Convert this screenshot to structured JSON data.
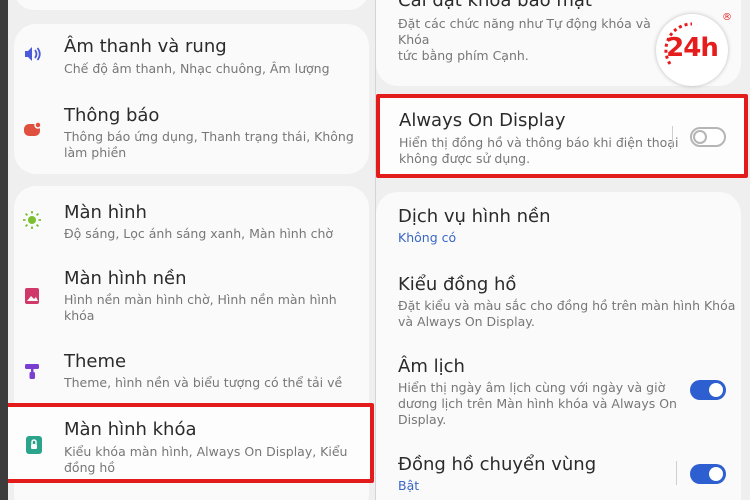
{
  "left_panel": {
    "items": [
      {
        "title": "Âm thanh và rung",
        "subtitle": "Chế độ âm thanh, Nhạc chuông, Âm lượng",
        "icon": "speaker-icon",
        "color": "#4a5ad8"
      },
      {
        "title": "Thông báo",
        "subtitle_lines": [
          "Thông báo ứng dụng, Thanh trạng thái, Không",
          "làm phiền"
        ],
        "icon": "notification-icon",
        "color": "#e0503f"
      },
      {
        "title": "Màn hình",
        "subtitle": "Độ sáng, Lọc ánh sáng xanh, Màn hình chờ",
        "icon": "brightness-icon",
        "color": "#7cbf2f"
      },
      {
        "title": "Màn hình nền",
        "subtitle_lines": [
          "Hình nền màn hình chờ, Hình nền màn hình",
          "khóa"
        ],
        "icon": "wallpaper-icon",
        "color": "#d03868"
      },
      {
        "title": "Theme",
        "subtitle": "Theme, hình nền và biểu tượng có thể tải về",
        "icon": "theme-icon",
        "color": "#7a3fd0"
      },
      {
        "title": "Màn hình khóa",
        "subtitle_lines": [
          "Kiểu khóa màn hình, Always On Display, Kiểu",
          "đồng hồ"
        ],
        "icon": "lock-screen-icon",
        "color": "#2aa58c"
      }
    ]
  },
  "right_panel": {
    "items": [
      {
        "title": "Cài đặt khóa bảo mật",
        "subtitle_lines": [
          "Đặt các chức năng như Tự động khóa và Khóa",
          "tức bằng phím Cạnh."
        ]
      },
      {
        "title": "Always On Display",
        "subtitle_lines": [
          "Hiển thị đồng hồ và thông báo khi điện thoại",
          "không được sử dụng."
        ],
        "toggle": "off"
      },
      {
        "title": "Dịch vụ hình nền",
        "subtitle": "Không có"
      },
      {
        "title": "Kiểu đồng hồ",
        "subtitle_lines": [
          "Đặt kiểu và màu sắc cho đồng hồ trên màn hình Khóa",
          "và Always On Display."
        ]
      },
      {
        "title": "Âm lịch",
        "subtitle_lines": [
          "Hiển thị ngày âm lịch cùng với ngày và giờ",
          "dương lịch trên Màn hình khóa và Always On",
          "Display."
        ],
        "toggle": "on"
      },
      {
        "title": "Đồng hồ chuyển vùng",
        "subtitle": "Bật",
        "toggle": "on"
      }
    ]
  },
  "logo": {
    "text": "24h",
    "reg": "®"
  },
  "colors": {
    "highlight": "#e31b1b",
    "accent": "#2e5fd0",
    "link": "#3a66c4"
  }
}
